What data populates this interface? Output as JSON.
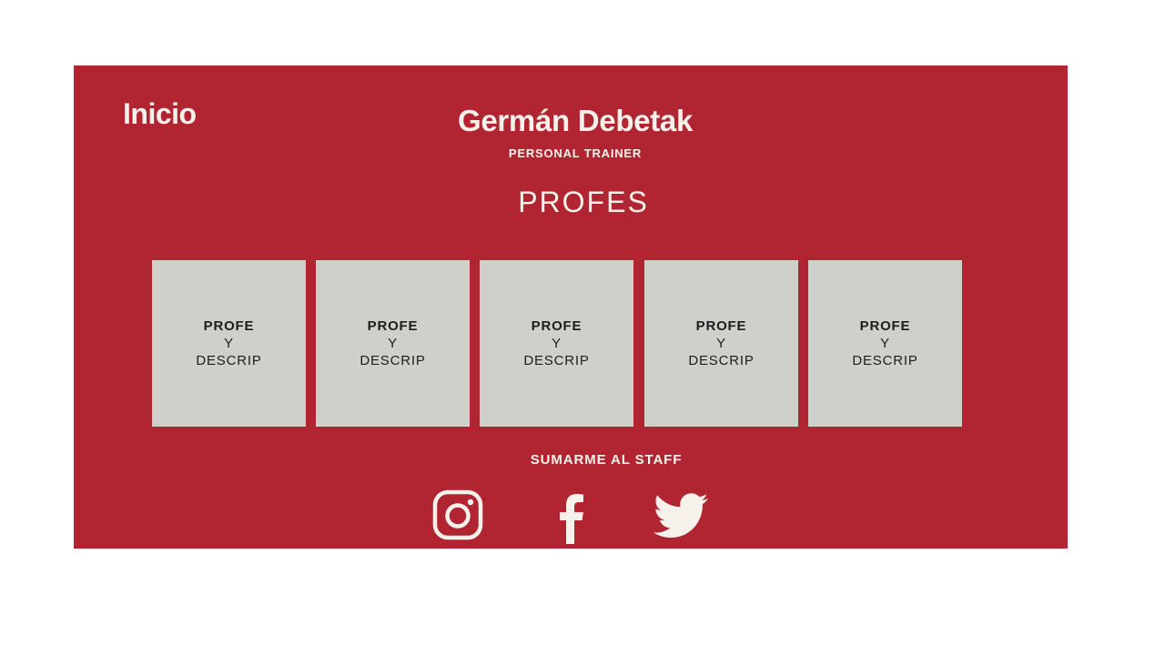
{
  "nav": {
    "home_label": "Inicio"
  },
  "brand": {
    "name": "Germán Debetak",
    "subtitle": "PERSONAL TRAINER"
  },
  "section": {
    "title": "PROFES"
  },
  "cards": [
    {
      "line1": "PROFE",
      "line2": "Y",
      "line3": "DESCRIP"
    },
    {
      "line1": "PROFE",
      "line2": "Y",
      "line3": "DESCRIP"
    },
    {
      "line1": "PROFE",
      "line2": "Y",
      "line3": "DESCRIP"
    },
    {
      "line1": "PROFE",
      "line2": "Y",
      "line3": "DESCRIP"
    },
    {
      "line1": "PROFE",
      "line2": "Y",
      "line3": "DESCRIP"
    }
  ],
  "staff": {
    "label": "SUMARME AL STAFF"
  },
  "social": [
    {
      "icon": "instagram-icon"
    },
    {
      "icon": "facebook-icon"
    },
    {
      "icon": "twitter-icon"
    }
  ],
  "colors": {
    "panel": "#b12532",
    "text_light": "#f6f1ea",
    "card_bg": "#d0d0cb",
    "card_text": "#1d1d1d",
    "page_bg": "#ffffff"
  }
}
